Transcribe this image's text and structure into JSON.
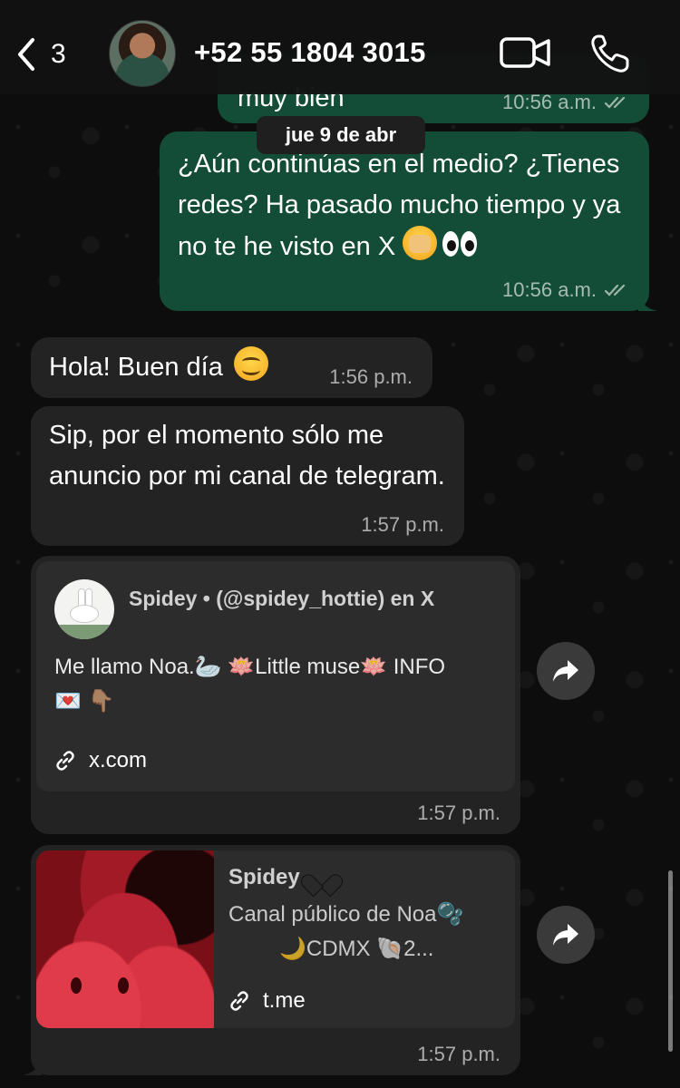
{
  "header": {
    "back_count": "3",
    "contact": "+52 55 1804 3015"
  },
  "chat": {
    "date_separator": "jue 9 de abr",
    "messages": [
      {
        "id": "m0",
        "direction": "out",
        "text": "muy bien",
        "time": "10:56 a.m.",
        "status": "read"
      },
      {
        "id": "m1",
        "direction": "out",
        "text": "¿Aún continúas en el medio? ¿Tienes redes? Ha pasado mucho tiempo y ya no te he visto en X",
        "emojis": [
          "face-with-hand-over-mouth",
          "eyes"
        ],
        "time": "10:56 a.m.",
        "status": "read"
      },
      {
        "id": "m2",
        "direction": "in",
        "text": "Hola! Buen día",
        "emojis": [
          "smiling-face"
        ],
        "time": "1:56 p.m."
      },
      {
        "id": "m3",
        "direction": "in",
        "text": "Sip, por el momento sólo me anuncio por mi canal de telegram.",
        "time": "1:57 p.m."
      },
      {
        "id": "m4",
        "direction": "in",
        "time": "1:57 p.m.",
        "preview": {
          "title": "Spidey • (@spidey_hottie) en X",
          "description": "Me llamo Noa.🦢  🪷Little muse🪷  INFO",
          "description_line2": "💌  👇🏽",
          "link": "x.com"
        }
      },
      {
        "id": "m5",
        "direction": "in",
        "time": "1:57 p.m.",
        "preview": {
          "title": "Spidey",
          "description": "Canal público de Noa🫧",
          "description_line2": "🌙CDMX        🐚2...",
          "link": "t.me"
        }
      }
    ]
  },
  "colors": {
    "outgoing_bubble": "#134d37",
    "incoming_bubble": "#232323",
    "preview_card": "#2c2c2c",
    "background": "#0d0d0d",
    "read_ticks": "#9fb5a8"
  },
  "icons": [
    "chevron-left-icon",
    "video-call-icon",
    "phone-icon",
    "link-icon",
    "forward-icon",
    "double-check-icon"
  ]
}
